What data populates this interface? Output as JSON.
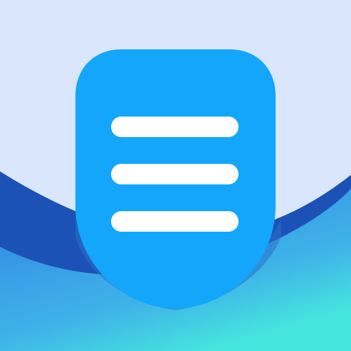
{
  "icon": {
    "name": "document-lines-icon",
    "line_count": 3
  },
  "colors": {
    "background_top": "#D9E6FB",
    "wave_dark": "#1C52B5",
    "wave_mid": "#2F7FE4",
    "wave_gradient_end": "#46E6DE",
    "shape_shadow": "#2A6FC8",
    "document_shape": "#13A6FB",
    "lines": "#FFFFFF"
  }
}
